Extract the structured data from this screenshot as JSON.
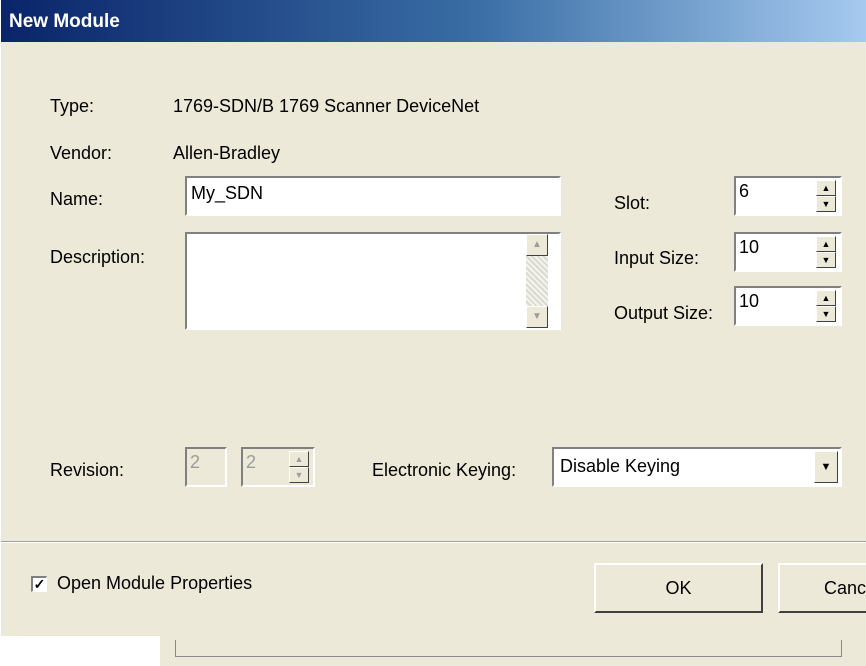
{
  "window": {
    "title": "New Module"
  },
  "fields": {
    "type_label": "Type:",
    "type_value": "1769-SDN/B 1769 Scanner DeviceNet",
    "vendor_label": "Vendor:",
    "vendor_value": "Allen-Bradley",
    "name_label": "Name:",
    "name_value": "My_SDN",
    "description_label": "Description:",
    "description_value": "",
    "slot_label": "Slot:",
    "slot_value": "6",
    "input_size_label": "Input Size:",
    "input_size_value": "10",
    "output_size_label": "Output Size:",
    "output_size_value": "10",
    "revision_label": "Revision:",
    "revision_major": "2",
    "revision_minor": "2",
    "keying_label": "Electronic Keying:",
    "keying_value": "Disable Keying"
  },
  "footer": {
    "open_properties_label": "Open Module Properties",
    "open_properties_checked": true,
    "ok_label": "OK",
    "cancel_label": "Canc"
  },
  "icons": {
    "spin_up": "up-arrow-icon",
    "spin_down": "down-arrow-icon",
    "dropdown": "chevron-down-icon",
    "check": "checkmark-icon"
  }
}
